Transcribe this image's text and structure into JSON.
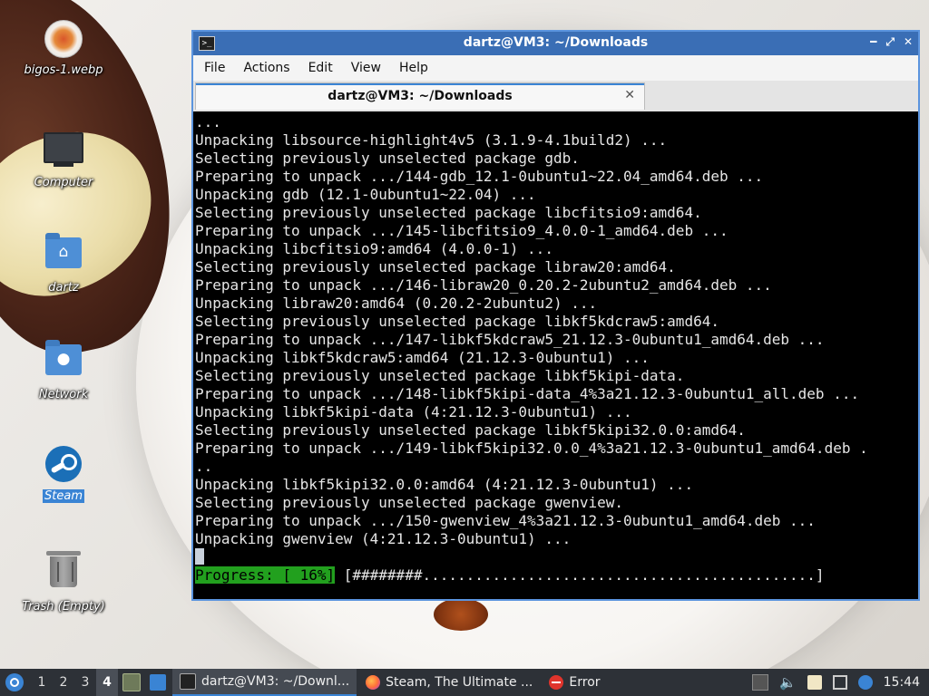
{
  "desktop": {
    "icons": [
      {
        "label": "bigos-1.webp",
        "icon": "image-thumbnail-icon"
      },
      {
        "label": "Computer",
        "icon": "computer-icon"
      },
      {
        "label": "dartz",
        "icon": "home-folder-icon"
      },
      {
        "label": "Network",
        "icon": "network-folder-icon"
      },
      {
        "label": "Steam",
        "icon": "steam-icon",
        "selected": true
      },
      {
        "label": "Trash (Empty)",
        "icon": "trash-icon"
      }
    ]
  },
  "terminal": {
    "title": "dartz@VM3: ~/Downloads",
    "menu": [
      "File",
      "Actions",
      "Edit",
      "View",
      "Help"
    ],
    "tab_title": "dartz@VM3: ~/Downloads",
    "lines": [
      "...",
      "Unpacking libsource-highlight4v5 (3.1.9-4.1build2) ...",
      "Selecting previously unselected package gdb.",
      "Preparing to unpack .../144-gdb_12.1-0ubuntu1~22.04_amd64.deb ...",
      "Unpacking gdb (12.1-0ubuntu1~22.04) ...",
      "Selecting previously unselected package libcfitsio9:amd64.",
      "Preparing to unpack .../145-libcfitsio9_4.0.0-1_amd64.deb ...",
      "Unpacking libcfitsio9:amd64 (4.0.0-1) ...",
      "Selecting previously unselected package libraw20:amd64.",
      "Preparing to unpack .../146-libraw20_0.20.2-2ubuntu2_amd64.deb ...",
      "Unpacking libraw20:amd64 (0.20.2-2ubuntu2) ...",
      "Selecting previously unselected package libkf5kdcraw5:amd64.",
      "Preparing to unpack .../147-libkf5kdcraw5_21.12.3-0ubuntu1_amd64.deb ...",
      "Unpacking libkf5kdcraw5:amd64 (21.12.3-0ubuntu1) ...",
      "Selecting previously unselected package libkf5kipi-data.",
      "Preparing to unpack .../148-libkf5kipi-data_4%3a21.12.3-0ubuntu1_all.deb ...",
      "Unpacking libkf5kipi-data (4:21.12.3-0ubuntu1) ...",
      "Selecting previously unselected package libkf5kipi32.0.0:amd64.",
      "Preparing to unpack .../149-libkf5kipi32.0.0_4%3a21.12.3-0ubuntu1_amd64.deb .",
      "..",
      "Unpacking libkf5kipi32.0.0:amd64 (4:21.12.3-0ubuntu1) ...",
      "Selecting previously unselected package gwenview.",
      "Preparing to unpack .../150-gwenview_4%3a21.12.3-0ubuntu1_amd64.deb ...",
      "Unpacking gwenview (4:21.12.3-0ubuntu1) ..."
    ],
    "progress_label": "Progress: [ 16%]",
    "progress_bar": " [########.............................................]",
    "progress_percent": 16
  },
  "taskbar": {
    "workspaces": [
      "1",
      "2",
      "3",
      "4"
    ],
    "active_workspace": "4",
    "tasks": [
      {
        "label": "dartz@VM3: ~/Downl...",
        "icon": "terminal-icon",
        "active": true
      },
      {
        "label": "Steam, The Ultimate ...",
        "icon": "firefox-icon",
        "active": false
      },
      {
        "label": "Error",
        "icon": "error-icon",
        "active": false
      }
    ],
    "clock": "15:44"
  },
  "colors": {
    "accent": "#3a84d4",
    "titlebar": "#3a6eb5",
    "progress": "#22a01e",
    "terminal_bg": "#000000",
    "taskbar_bg": "#2d3137"
  }
}
